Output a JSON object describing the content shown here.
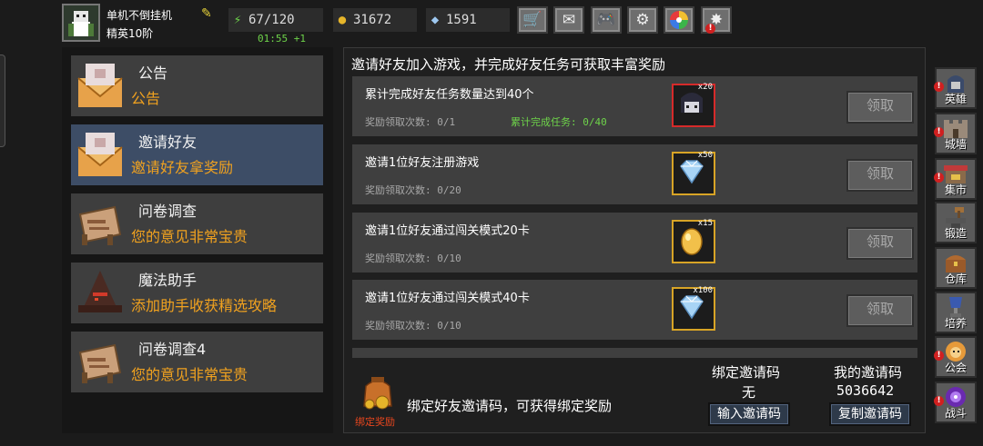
{
  "player": {
    "name": "单机不倒挂机",
    "rank": "精英10阶"
  },
  "resources": {
    "energy": "67/120",
    "timer": "01:55 +1",
    "gold": "31672",
    "gems": "1591"
  },
  "toolbar_icons": [
    "shop-cart-icon",
    "mail-icon",
    "gamepad-icon",
    "settings-gear-icon",
    "color-wheel-icon",
    "firework-icon"
  ],
  "menu": [
    {
      "title": "公告",
      "subtitle": "公告"
    },
    {
      "title": "邀请好友",
      "subtitle": "邀请好友拿奖励"
    },
    {
      "title": "问卷调查",
      "subtitle": "您的意见非常宝贵"
    },
    {
      "title": "魔法助手",
      "subtitle": "添加助手收获精选攻略"
    },
    {
      "title": "问卷调查4",
      "subtitle": "您的意见非常宝贵"
    }
  ],
  "main": {
    "header": "邀请好友加入游戏，并完成好友任务可获取丰富奖励",
    "quests": [
      {
        "title": "累计完成好友任务数量达到40个",
        "count": "奖励领取次数: 0/1",
        "progress": "累计完成任务: 0/40",
        "qty": "x20",
        "claim": "领取"
      },
      {
        "title": "邀请1位好友注册游戏",
        "count": "奖励领取次数: 0/20",
        "progress": "",
        "qty": "x50",
        "claim": "领取"
      },
      {
        "title": "邀请1位好友通过闯关模式20卡",
        "count": "奖励领取次数: 0/10",
        "progress": "",
        "qty": "x15",
        "claim": "领取"
      },
      {
        "title": "邀请1位好友通过闯关模式40卡",
        "count": "奖励领取次数: 0/10",
        "progress": "",
        "qty": "x100",
        "claim": "领取"
      }
    ],
    "bottom": {
      "icon_label": "绑定奖励",
      "message": "绑定好友邀请码，可获得绑定奖励",
      "bind_header": "绑定邀请码",
      "bind_value": "无",
      "my_header": "我的邀请码",
      "my_value": "5036642",
      "input_btn": "输入邀请码",
      "copy_btn": "复制邀请码"
    }
  },
  "nav": [
    {
      "label": "英雄",
      "badge": true
    },
    {
      "label": "城墙",
      "badge": true
    },
    {
      "label": "集市",
      "badge": true
    },
    {
      "label": "锻造",
      "badge": false
    },
    {
      "label": "仓库",
      "badge": false
    },
    {
      "label": "培养",
      "badge": false
    },
    {
      "label": "公会",
      "badge": true
    },
    {
      "label": "战斗",
      "badge": true
    }
  ],
  "colors": {
    "accent_orange": "#f1a21f",
    "progress_green": "#6ed34a",
    "active_bg": "#3d4d66",
    "badge_red": "#d02020"
  }
}
